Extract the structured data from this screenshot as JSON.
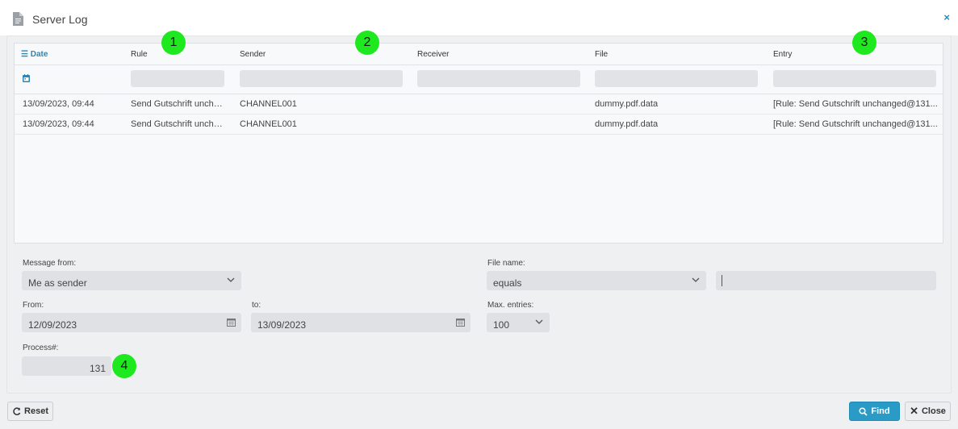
{
  "window": {
    "title": "Server Log",
    "close_label": "×"
  },
  "grid": {
    "columns": [
      "Date",
      "Rule",
      "Sender",
      "Receiver",
      "File",
      "Entry"
    ],
    "rows": [
      {
        "date": "13/09/2023, 09:44",
        "rule": "Send Gutschrift unchanged",
        "sender": "CHANNEL001",
        "receiver": "",
        "file": "dummy.pdf.data",
        "entry": "[Rule: Send Gutschrift unchanged@131..."
      },
      {
        "date": "13/09/2023, 09:44",
        "rule": "Send Gutschrift unchanged",
        "sender": "CHANNEL001",
        "receiver": "",
        "file": "dummy.pdf.data",
        "entry": "[Rule: Send Gutschrift unchanged@131..."
      }
    ]
  },
  "form": {
    "message_from": {
      "label": "Message from:",
      "value": "Me as sender"
    },
    "file_name": {
      "label": "File name:",
      "operator": "equals",
      "value": ""
    },
    "from": {
      "label": "From:",
      "value": "12/09/2023"
    },
    "to": {
      "label": "to:",
      "value": "13/09/2023"
    },
    "max_entries": {
      "label": "Max. entries:",
      "value": "100"
    },
    "process": {
      "label": "Process#:",
      "value": "131"
    }
  },
  "badges": [
    "1",
    "2",
    "3",
    "4"
  ],
  "buttons": {
    "reset": "Reset",
    "find": "Find",
    "close": "Close"
  },
  "colors": {
    "accent": "#2a87b8",
    "primary_button": "#2a9bc7",
    "badge": "#1ee81e"
  }
}
